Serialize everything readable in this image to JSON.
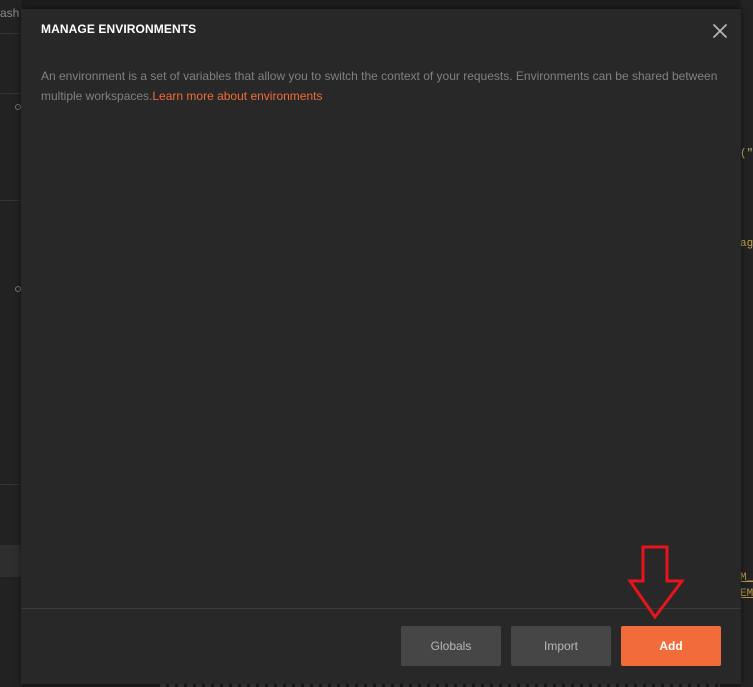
{
  "background": {
    "left_fragment": "ash",
    "right_fragments": [
      "(\"",
      "ag",
      "M_S",
      "EM"
    ]
  },
  "modal": {
    "title": "MANAGE ENVIRONMENTS",
    "close_icon": "close-icon",
    "description": "An environment is a set of variables that allow you to switch the context of your requests. Environments can be shared between multiple workspaces.",
    "learn_more_label": "Learn more about environments",
    "footer": {
      "globals_label": "Globals",
      "import_label": "Import",
      "add_label": "Add"
    }
  },
  "annotation": {
    "icon": "down-arrow-annotation-icon",
    "color": "#e8141c"
  },
  "colors": {
    "accent": "#f26b3a",
    "modal_bg": "#282828",
    "secondary_button": "#464646"
  }
}
